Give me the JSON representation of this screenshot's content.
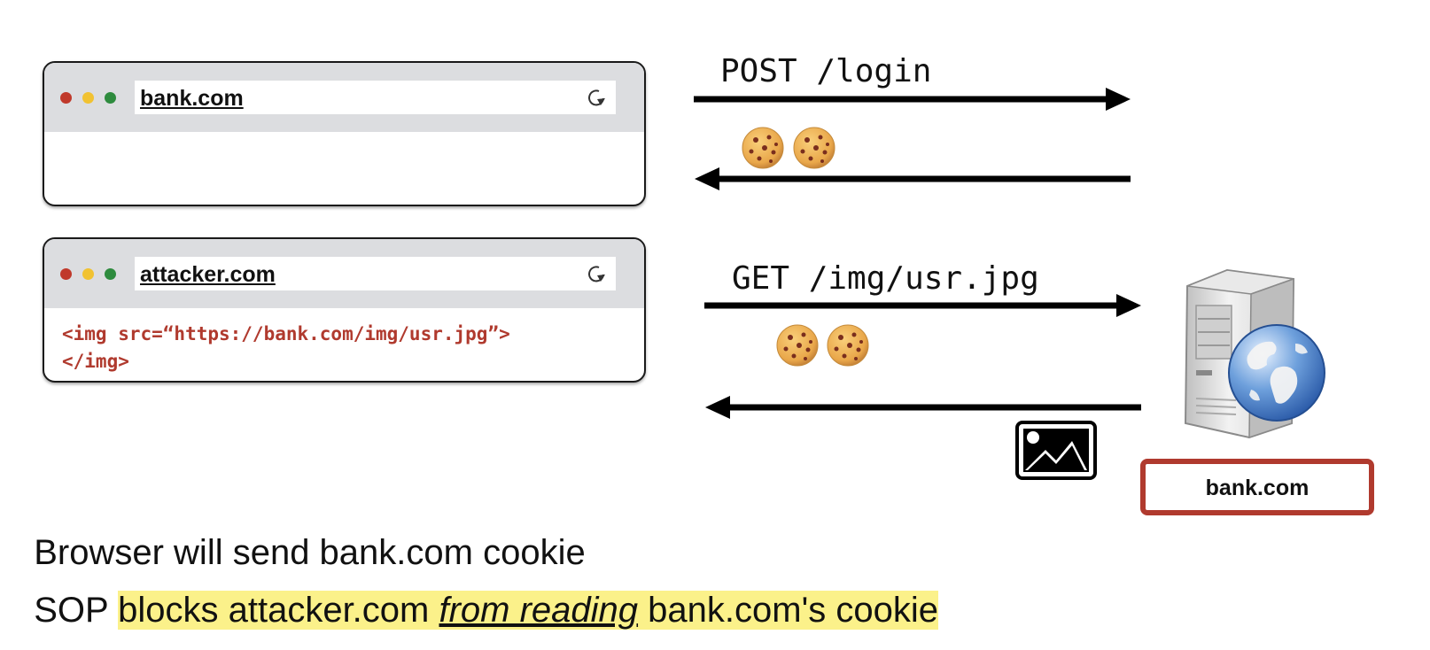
{
  "browsers": [
    {
      "url": "bank.com",
      "code_lines": []
    },
    {
      "url": "attacker.com",
      "code_lines": [
        "<img src=“https://bank.com/img/usr.jpg”>",
        "</img>"
      ]
    }
  ],
  "flows": {
    "post_label": "POST /login",
    "get_label": "GET /img/usr.jpg"
  },
  "server": {
    "name": "bank.com"
  },
  "captions": {
    "line1": "Browser will send bank.com cookie",
    "line2_prefix": "SOP ",
    "line2_hl_a": "blocks attacker.com ",
    "line2_hl_em": "from reading",
    "line2_hl_b": " bank.com's cookie"
  },
  "colors": {
    "accent_red": "#b03a2e",
    "highlight": "#fbf18a",
    "titlebar": "#dcdde0"
  }
}
